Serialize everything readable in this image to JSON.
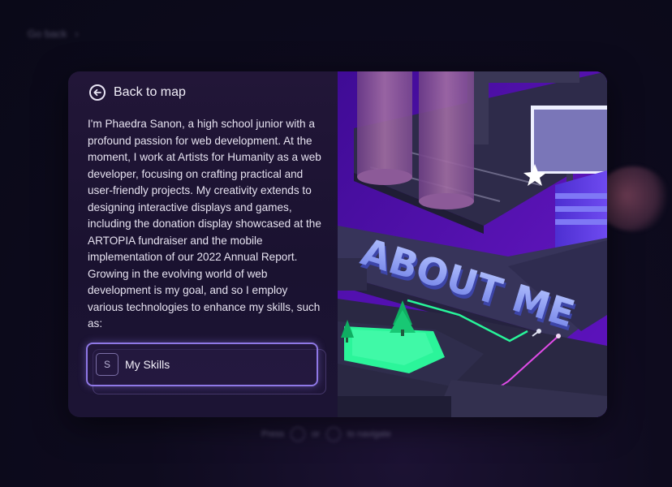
{
  "background": {
    "breadcrumb_blurred": "Go back",
    "hint_press": "Press",
    "hint_or": "or",
    "hint_to_navigate": "to navigate"
  },
  "panel": {
    "back_label": "Back to map",
    "bio": "I'm Phaedra Sanon, a high school junior with a profound passion for web development. At the moment, I work at Artists for Humanity as a web developer, focusing on crafting practical and user-friendly projects. My creativity extends to designing interactive displays and games, including the donation display showcased at the ARTOPIA fundraiser and the mobile implementation of our 2022 Annual Report. Growing in the evolving world of web development is my goal, and so I employ various technologies to enhance my skills, such as:",
    "skill_button": {
      "key": "S",
      "label": "My Skills"
    }
  },
  "illustration": {
    "sign_text": "ABOUT ME"
  },
  "colors": {
    "accent": "#8f78e6",
    "panel_bg": "#1d1433",
    "page_bg": "#0c0a1c",
    "floor_purple": "#5b12b8",
    "neon_green": "#28f59a",
    "neon_pink": "#e04be8"
  }
}
